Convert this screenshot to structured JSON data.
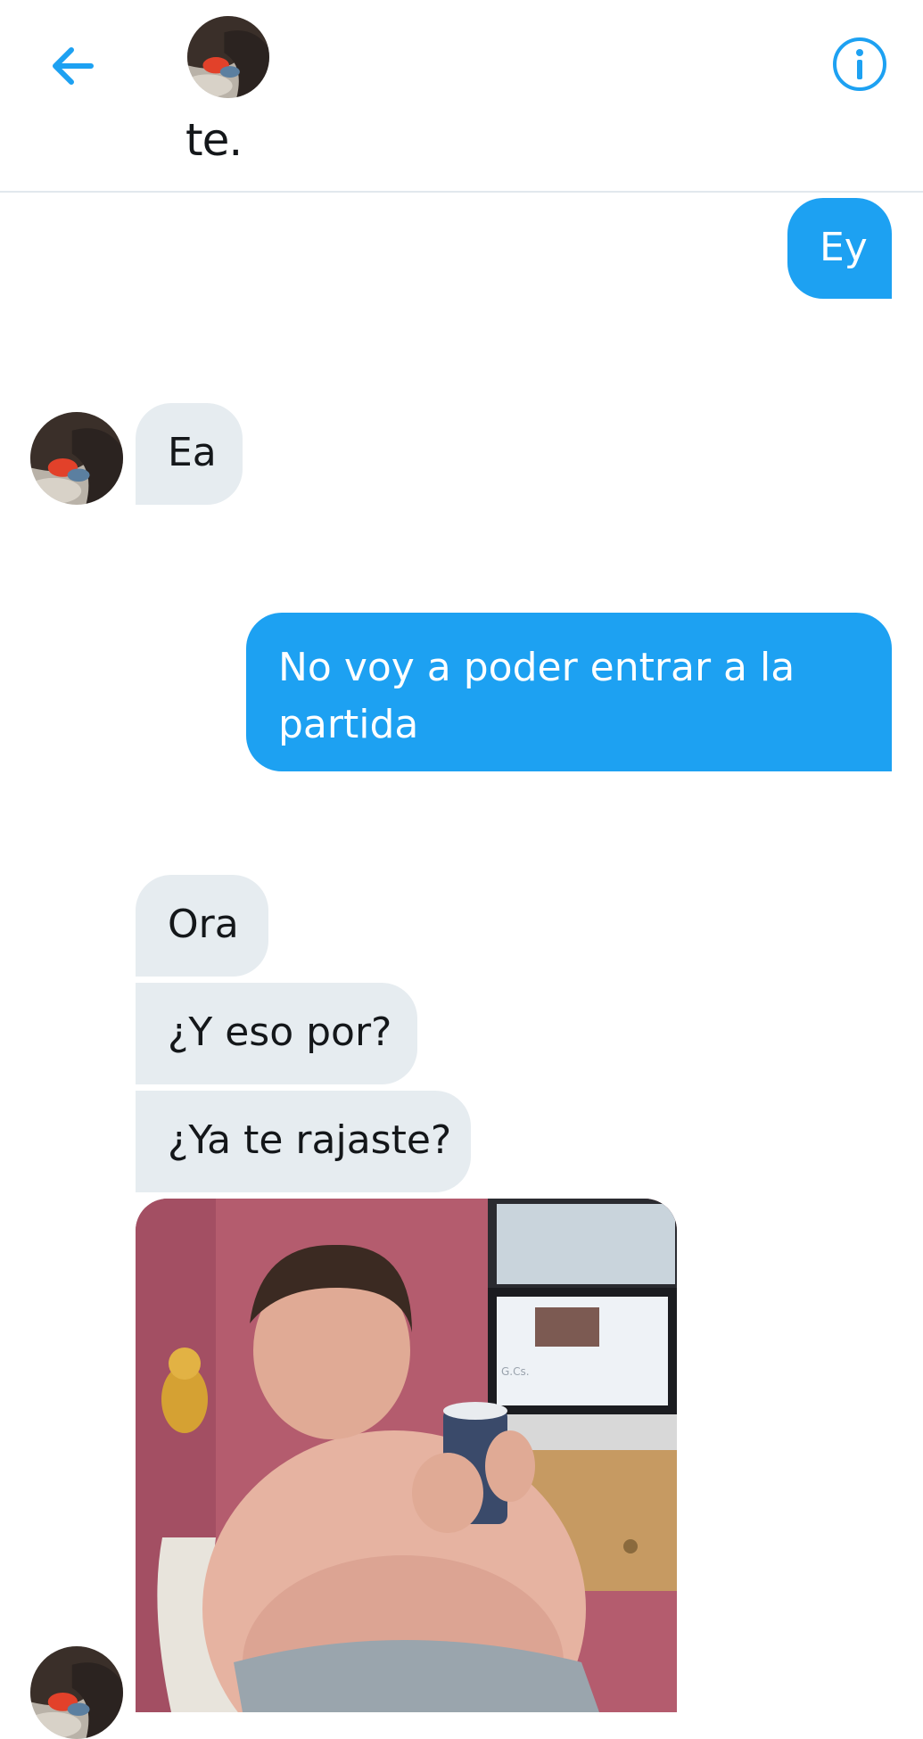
{
  "header": {
    "contact_name": "te.",
    "back_icon": "arrow-left-icon",
    "info_icon": "info-icon",
    "accent": "#1da1f2"
  },
  "messages": [
    {
      "direction": "outgoing",
      "text": "Ey"
    },
    {
      "direction": "incoming",
      "text": "Ea"
    },
    {
      "direction": "outgoing",
      "text": "No voy a poder entrar a la partida"
    },
    {
      "direction": "incoming",
      "text": "Ora"
    },
    {
      "direction": "incoming",
      "text": "¿Y eso por?"
    },
    {
      "direction": "incoming",
      "text": "¿Ya te rajaste?"
    },
    {
      "direction": "incoming",
      "type": "image"
    }
  ],
  "colors": {
    "outgoing_bubble": "#1da1f2",
    "incoming_bubble": "#e6ecf0",
    "divider": "#e1e8ed"
  }
}
